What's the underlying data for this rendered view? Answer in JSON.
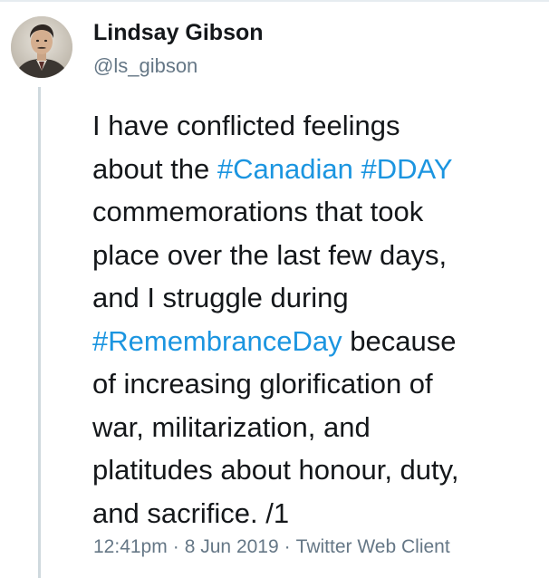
{
  "tweet": {
    "author": {
      "display_name": "Lindsay Gibson",
      "handle": "@ls_gibson"
    },
    "text_lines": [
      [
        {
          "t": "I have conflicted feelings",
          "h": false
        }
      ],
      [
        {
          "t": "about the ",
          "h": false
        },
        {
          "t": "#Canadian",
          "h": true
        },
        {
          "t": " ",
          "h": false
        },
        {
          "t": "#DDAY",
          "h": true
        }
      ],
      [
        {
          "t": "commemorations that took",
          "h": false
        }
      ],
      [
        {
          "t": "place over the last few days,",
          "h": false
        }
      ],
      [
        {
          "t": "and I struggle during",
          "h": false
        }
      ],
      [
        {
          "t": "#RemembranceDay",
          "h": true
        },
        {
          "t": " because",
          "h": false
        }
      ],
      [
        {
          "t": "of increasing glorification of",
          "h": false
        }
      ],
      [
        {
          "t": "war, militarization, and",
          "h": false
        }
      ],
      [
        {
          "t": "platitudes about honour, duty,",
          "h": false
        }
      ],
      [
        {
          "t": "and sacrifice.  /1",
          "h": false
        }
      ]
    ],
    "hashtags": [
      "#Canadian",
      "#DDAY",
      "#RemembranceDay"
    ],
    "time": "12:41pm",
    "date": "8 Jun 2019",
    "source": "Twitter Web Client",
    "separator": "·"
  },
  "colors": {
    "text": "#14171a",
    "secondary": "#657786",
    "link": "#1b95e0",
    "thread_line": "#cfd9de"
  },
  "icons": {
    "avatar": "user-avatar-portrait"
  }
}
